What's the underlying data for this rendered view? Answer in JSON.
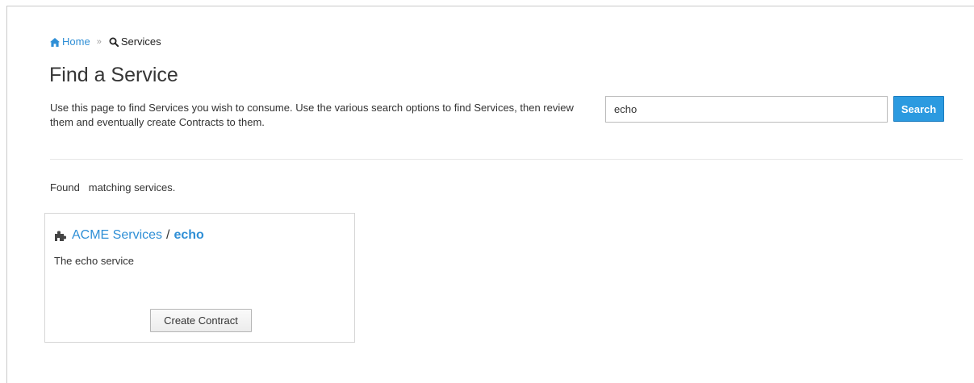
{
  "breadcrumb": {
    "home_icon": "home-icon",
    "home_label": "Home",
    "separator": "»",
    "current_icon": "search-icon",
    "current_label": "Services"
  },
  "header": {
    "title": "Find a Service",
    "description": "Use this page to find Services you wish to consume. Use the various search options to find Services, then review them and eventually create Contracts to them."
  },
  "search": {
    "value": "echo",
    "button_label": "Search"
  },
  "results": {
    "summary_prefix": "Found",
    "summary_count": "",
    "summary_suffix": "matching services.",
    "items": [
      {
        "icon": "puzzle-piece-icon",
        "organization": "ACME Services",
        "separator": "/",
        "service_name": "echo",
        "description": "The echo service",
        "action_label": "Create Contract"
      }
    ]
  },
  "colors": {
    "link": "#2f8fd6",
    "primary_button": "#2b9ae0",
    "text": "#333333"
  }
}
